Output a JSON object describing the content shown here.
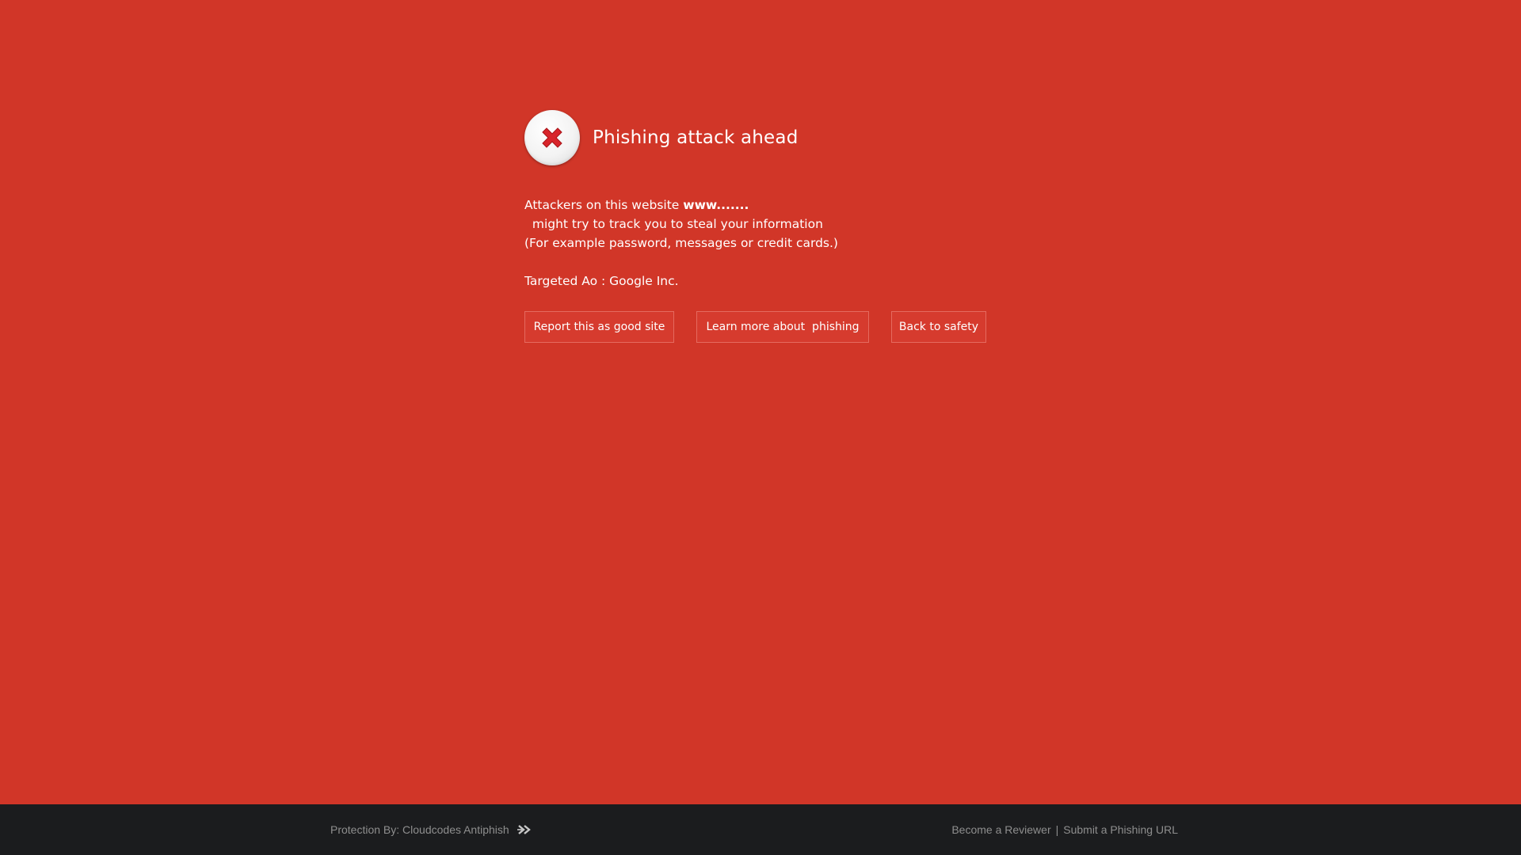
{
  "warning": {
    "icon": "error-x-icon",
    "title": "Phishing attack ahead",
    "desc_prefix": "Attackers on this website ",
    "site": "www.......",
    "desc_suffix": "  might try to track you to steal your information",
    "desc_line2": "(For example password, messages or credit cards.)",
    "targeted": "Targeted Ao : Google Inc."
  },
  "buttons": {
    "report": "Report this as good site",
    "learn": "Learn more about  phishing",
    "back": "Back to safety"
  },
  "footer": {
    "protection": "Protection By: Cloudcodes Antiphish",
    "protection_icon": "double-chevron-right-icon",
    "reviewer": "Become a Reviewer",
    "separator": "|",
    "submit": "Submit a Phishing URL"
  },
  "colors": {
    "background": "#d13628",
    "footer": "#1b1c1e",
    "icon_x": "#d8252b"
  }
}
